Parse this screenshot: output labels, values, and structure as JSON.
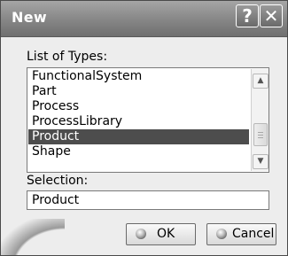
{
  "window": {
    "title": "New",
    "help_glyph": "?",
    "close_glyph": "✕"
  },
  "list_section": {
    "label": "List of Types:",
    "items": [
      "FunctionalSystem",
      "Part",
      "Process",
      "ProcessLibrary",
      "Product",
      "Shape"
    ],
    "selected_index": 4,
    "scroll_up_glyph": "▲",
    "scroll_down_glyph": "▼"
  },
  "selection": {
    "label": "Selection:",
    "value": "Product"
  },
  "buttons": {
    "ok_label": "OK",
    "cancel_label": "Cancel"
  },
  "colors": {
    "selected_row_bg": "#4d4d4d",
    "titlebar": "#8b8b8b"
  },
  "icons": {
    "help": "help-icon",
    "close": "close-icon",
    "button_bullet": "bullet-icon"
  }
}
